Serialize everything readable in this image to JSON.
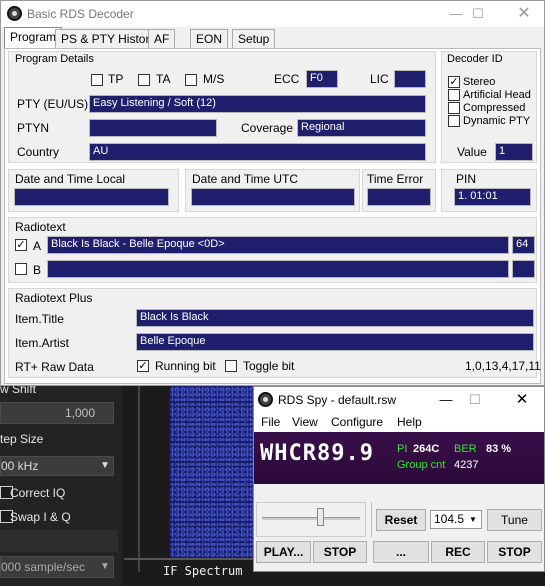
{
  "sdr": {
    "shift_label": "w Shift",
    "shift_value": "1,000",
    "step_label": "tep Size",
    "step_value": "00 kHz",
    "correct_iq": "Correct IQ",
    "swap_iq": "Swap I & Q",
    "samplerate": "000 sample/sec",
    "spectrum_label": "IF Spectrum"
  },
  "rds": {
    "title": "Basic RDS Decoder",
    "tabs": [
      "Program",
      "PS & PTY History",
      "AF",
      "EON",
      "Setup"
    ],
    "program_details": {
      "title": "Program Details",
      "tp": "TP",
      "ta": "TA",
      "ms": "M/S",
      "ecc_label": "ECC",
      "ecc_value": "F0",
      "lic_label": "LIC",
      "lic_value": "",
      "pty_label": "PTY (EU/US)",
      "pty_value": "Easy Listening / Soft (12)",
      "ptyn_label": "PTYN",
      "ptyn_value": "",
      "coverage_label": "Coverage",
      "coverage_value": "Regional",
      "country_label": "Country",
      "country_value": "AU"
    },
    "decoder_id": {
      "title": "Decoder ID",
      "stereo": "Stereo",
      "stereo_checked": true,
      "artificial_head": "Artificial Head",
      "compressed": "Compressed",
      "dynamic_pty": "Dynamic PTY",
      "value_label": "Value",
      "value": "1"
    },
    "dt_local": "Date and Time Local",
    "dt_utc": "Date and Time UTC",
    "time_error": "Time Error",
    "pin_label": "PIN",
    "pin_value": "1. 01:01",
    "radiotext": {
      "title": "Radiotext",
      "a_label": "A",
      "a_text": "Black Is Black - Belle Epoque  <0D>",
      "a_count": "64",
      "b_label": "B",
      "b_text": "",
      "b_count": ""
    },
    "rtplus": {
      "title": "Radiotext Plus",
      "item_title_label": "Item.Title",
      "item_title": "Black Is Black",
      "item_artist_label": "Item.Artist",
      "item_artist": "Belle Epoque",
      "raw_label": "RT+ Raw Data",
      "running_bit": "Running bit",
      "toggle_bit": "Toggle bit",
      "raw_value": "1,0,13,4,17,11"
    }
  },
  "spy": {
    "title": "RDS Spy - default.rsw",
    "menu": [
      "File",
      "View",
      "Configure",
      "Help"
    ],
    "ps": "WHCR89.9",
    "pi_label": "PI",
    "pi_value": "264C",
    "ber_label": "BER",
    "ber_value": "83 %",
    "group_label": "Group cnt",
    "group_value": "4237",
    "reset": "Reset",
    "freq": "104.5",
    "tune": "Tune",
    "play": "PLAY...",
    "stop1": "STOP",
    "dots": "...",
    "rec": "REC",
    "stop2": "STOP"
  },
  "colors": {
    "field_bg": "#1f1f6e",
    "spy_green": "#30e830",
    "spy_bg": "#3a0f4a"
  }
}
